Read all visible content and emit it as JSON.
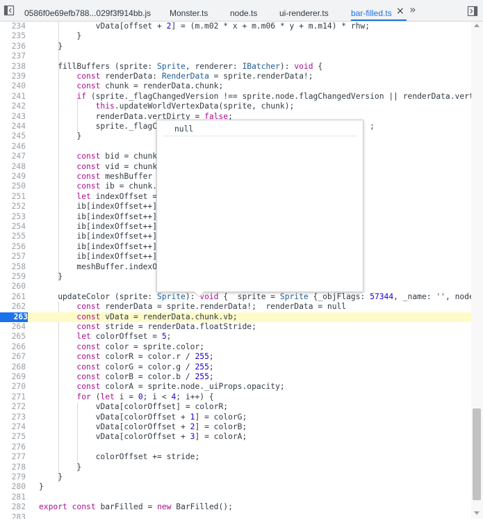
{
  "tabs": [
    {
      "label": "0586f0e69efb788...029f3f914bb.js",
      "active": false
    },
    {
      "label": "Monster.ts",
      "active": false
    },
    {
      "label": "node.ts",
      "active": false
    },
    {
      "label": "ui-renderer.ts",
      "active": false
    },
    {
      "label": "bar-filled.ts",
      "active": true
    }
  ],
  "tab_close_icon": "×",
  "tab_more_icon": "»",
  "colors": {
    "accent": "#1a73e8",
    "exec_line": "#fffbc8",
    "keyword": "#aa0d91",
    "type": "#1c5c96"
  },
  "popover": {
    "value": "null"
  },
  "lines": [
    {
      "n": "234",
      "text": "            vData[offset + 2] = (m.m02 * x + m.m06 * y + m.m14) * rhw;"
    },
    {
      "n": "235",
      "text": "        }"
    },
    {
      "n": "236",
      "text": "    }"
    },
    {
      "n": "237",
      "text": ""
    },
    {
      "n": "238",
      "text": "    fillBuffers (sprite: Sprite, renderer: IBatcher): void {"
    },
    {
      "n": "239",
      "text": "        const renderData: RenderData = sprite.renderData!;"
    },
    {
      "n": "240",
      "text": "        const chunk = renderData.chunk;"
    },
    {
      "n": "241",
      "text": "        if (sprite._flagChangedVersion !== sprite.node.flagChangedVersion || renderData.vertDi"
    },
    {
      "n": "242",
      "text": "            this.updateWorldVertexData(sprite, chunk);"
    },
    {
      "n": "243",
      "text": "            renderData.vertDirty = false;"
    },
    {
      "n": "244",
      "text": "            sprite._flagCh                                            ;"
    },
    {
      "n": "245",
      "text": "        }"
    },
    {
      "n": "246",
      "text": ""
    },
    {
      "n": "247",
      "text": "        const bid = chunk."
    },
    {
      "n": "248",
      "text": "        const vid = chunk."
    },
    {
      "n": "249",
      "text": "        const meshBuffer ="
    },
    {
      "n": "250",
      "text": "        const ib = chunk.m"
    },
    {
      "n": "251",
      "text": "        let indexOffset ="
    },
    {
      "n": "252",
      "text": "        ib[indexOffset++]"
    },
    {
      "n": "253",
      "text": "        ib[indexOffset++]"
    },
    {
      "n": "254",
      "text": "        ib[indexOffset++]"
    },
    {
      "n": "255",
      "text": "        ib[indexOffset++]"
    },
    {
      "n": "256",
      "text": "        ib[indexOffset++]"
    },
    {
      "n": "257",
      "text": "        ib[indexOffset++]"
    },
    {
      "n": "258",
      "text": "        meshBuffer.indexOf"
    },
    {
      "n": "259",
      "text": "    }"
    },
    {
      "n": "260",
      "text": ""
    },
    {
      "n": "261",
      "text": "    updateColor (sprite: Sprite): void {  sprite = Sprite {_objFlags: 57344, _name: '', node:"
    },
    {
      "n": "262",
      "text": "        const renderData = sprite.renderData!;  renderData = null"
    },
    {
      "n": "263",
      "text": "        const vData = renderData.chunk.vb;"
    },
    {
      "n": "264",
      "text": "        const stride = renderData.floatStride;"
    },
    {
      "n": "265",
      "text": "        let colorOffset = 5;"
    },
    {
      "n": "266",
      "text": "        const color = sprite.color;"
    },
    {
      "n": "267",
      "text": "        const colorR = color.r / 255;"
    },
    {
      "n": "268",
      "text": "        const colorG = color.g / 255;"
    },
    {
      "n": "269",
      "text": "        const colorB = color.b / 255;"
    },
    {
      "n": "270",
      "text": "        const colorA = sprite.node._uiProps.opacity;"
    },
    {
      "n": "271",
      "text": "        for (let i = 0; i < 4; i++) {"
    },
    {
      "n": "272",
      "text": "            vData[colorOffset] = colorR;"
    },
    {
      "n": "273",
      "text": "            vData[colorOffset + 1] = colorG;"
    },
    {
      "n": "274",
      "text": "            vData[colorOffset + 2] = colorB;"
    },
    {
      "n": "275",
      "text": "            vData[colorOffset + 3] = colorA;"
    },
    {
      "n": "276",
      "text": ""
    },
    {
      "n": "277",
      "text": "            colorOffset += stride;"
    },
    {
      "n": "278",
      "text": "        }"
    },
    {
      "n": "279",
      "text": "    }"
    },
    {
      "n": "280",
      "text": "}"
    },
    {
      "n": "281",
      "text": ""
    },
    {
      "n": "282",
      "text": "export const barFilled = new BarFilled();"
    },
    {
      "n": "283",
      "text": ""
    }
  ]
}
